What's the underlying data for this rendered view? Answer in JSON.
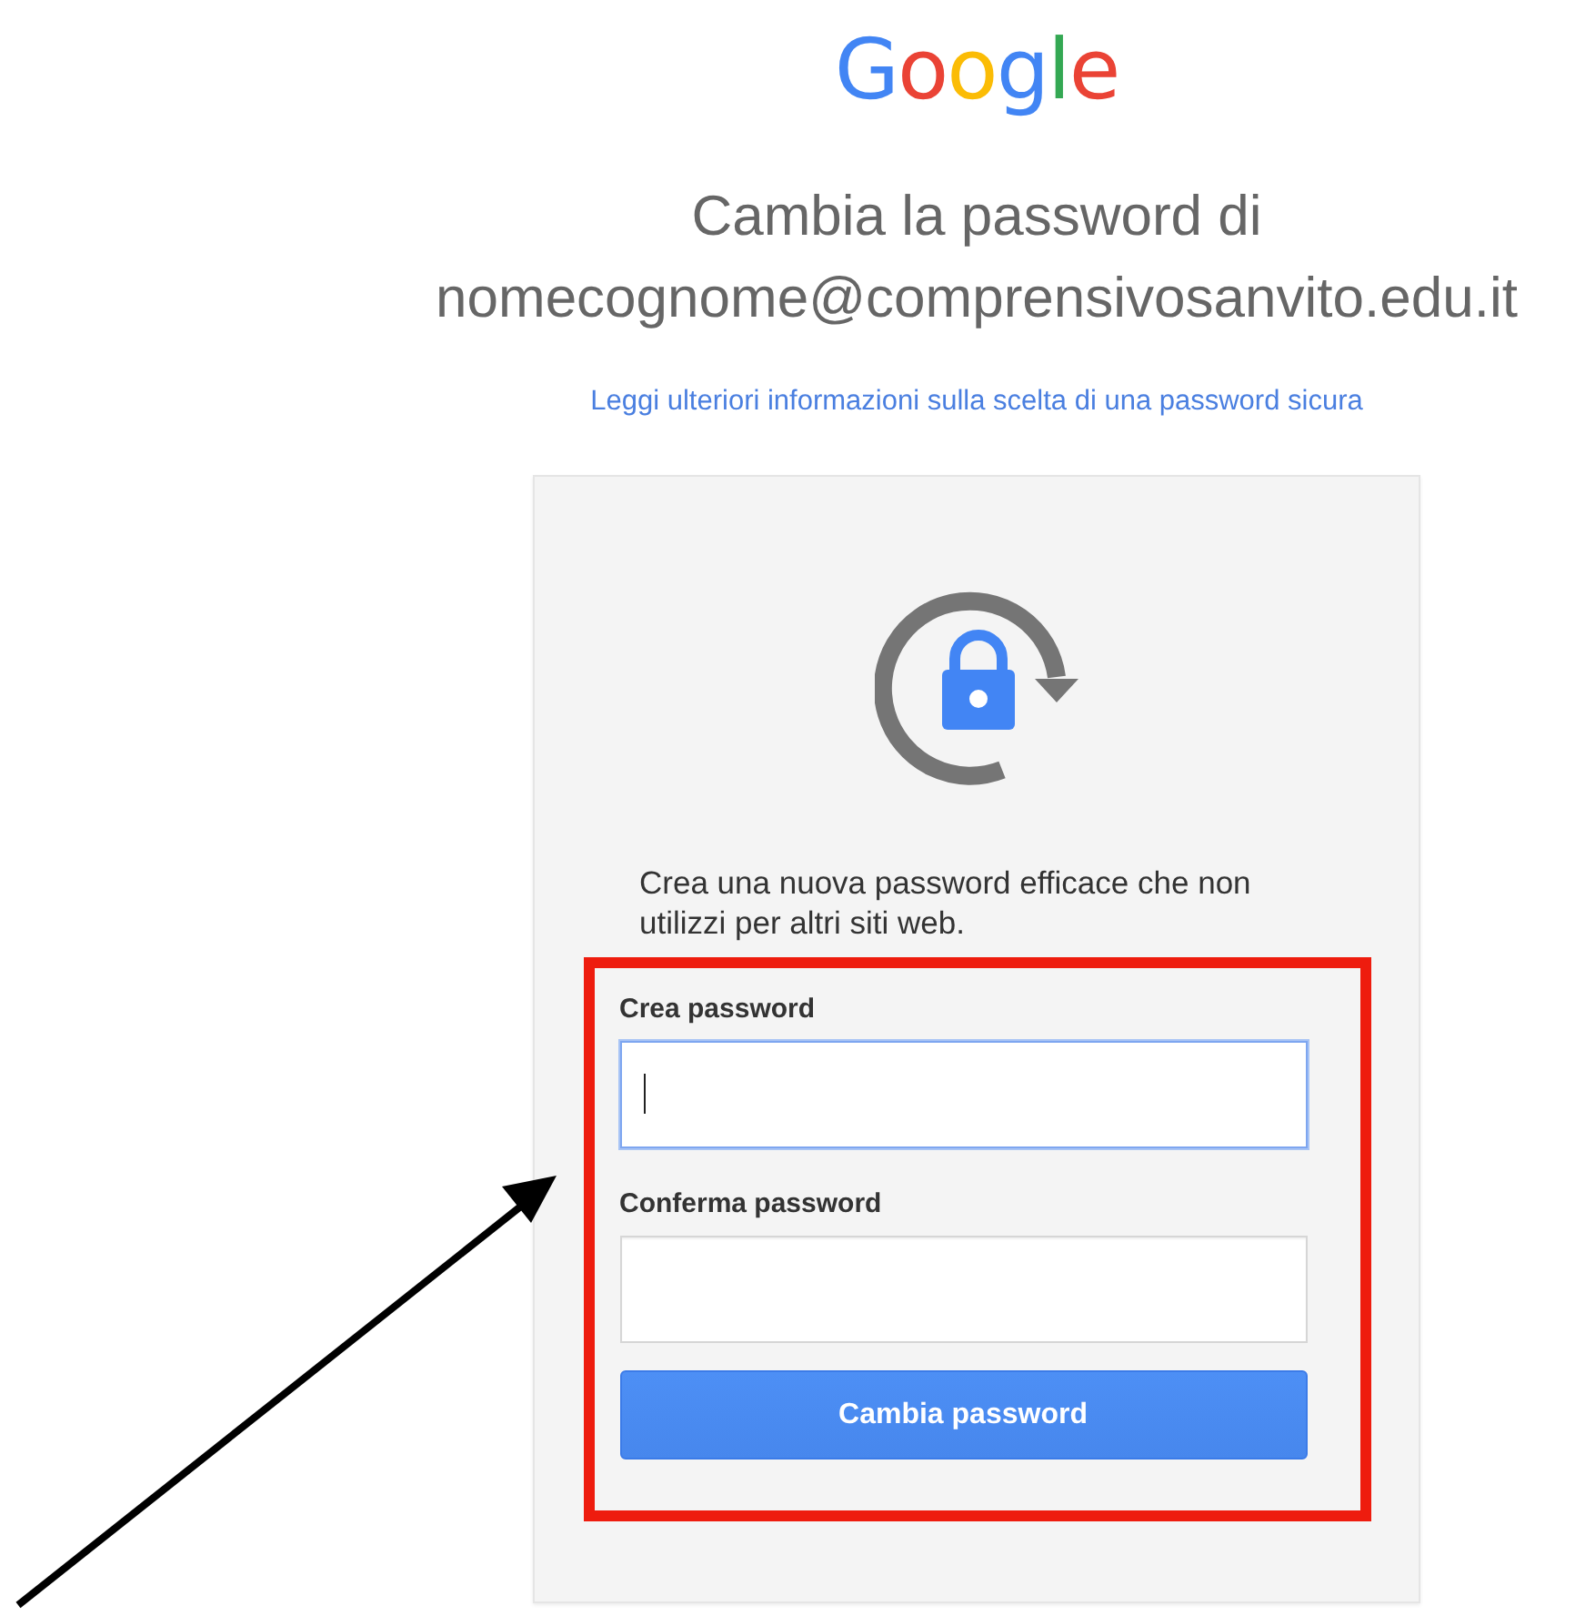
{
  "logo": "Google",
  "heading": {
    "title": "Cambia la password di",
    "account": "nomecognome@comprensivosanvito.edu.it"
  },
  "help_link": "Leggi ulteriori informazioni sulla scelta di una password sicura",
  "card": {
    "intro": "Crea una nuova password efficace che non utilizzi per altri siti web.",
    "fields": [
      {
        "label": "Crea password",
        "focused": true
      },
      {
        "label": "Conferma password",
        "focused": false
      }
    ],
    "button": "Cambia password"
  }
}
